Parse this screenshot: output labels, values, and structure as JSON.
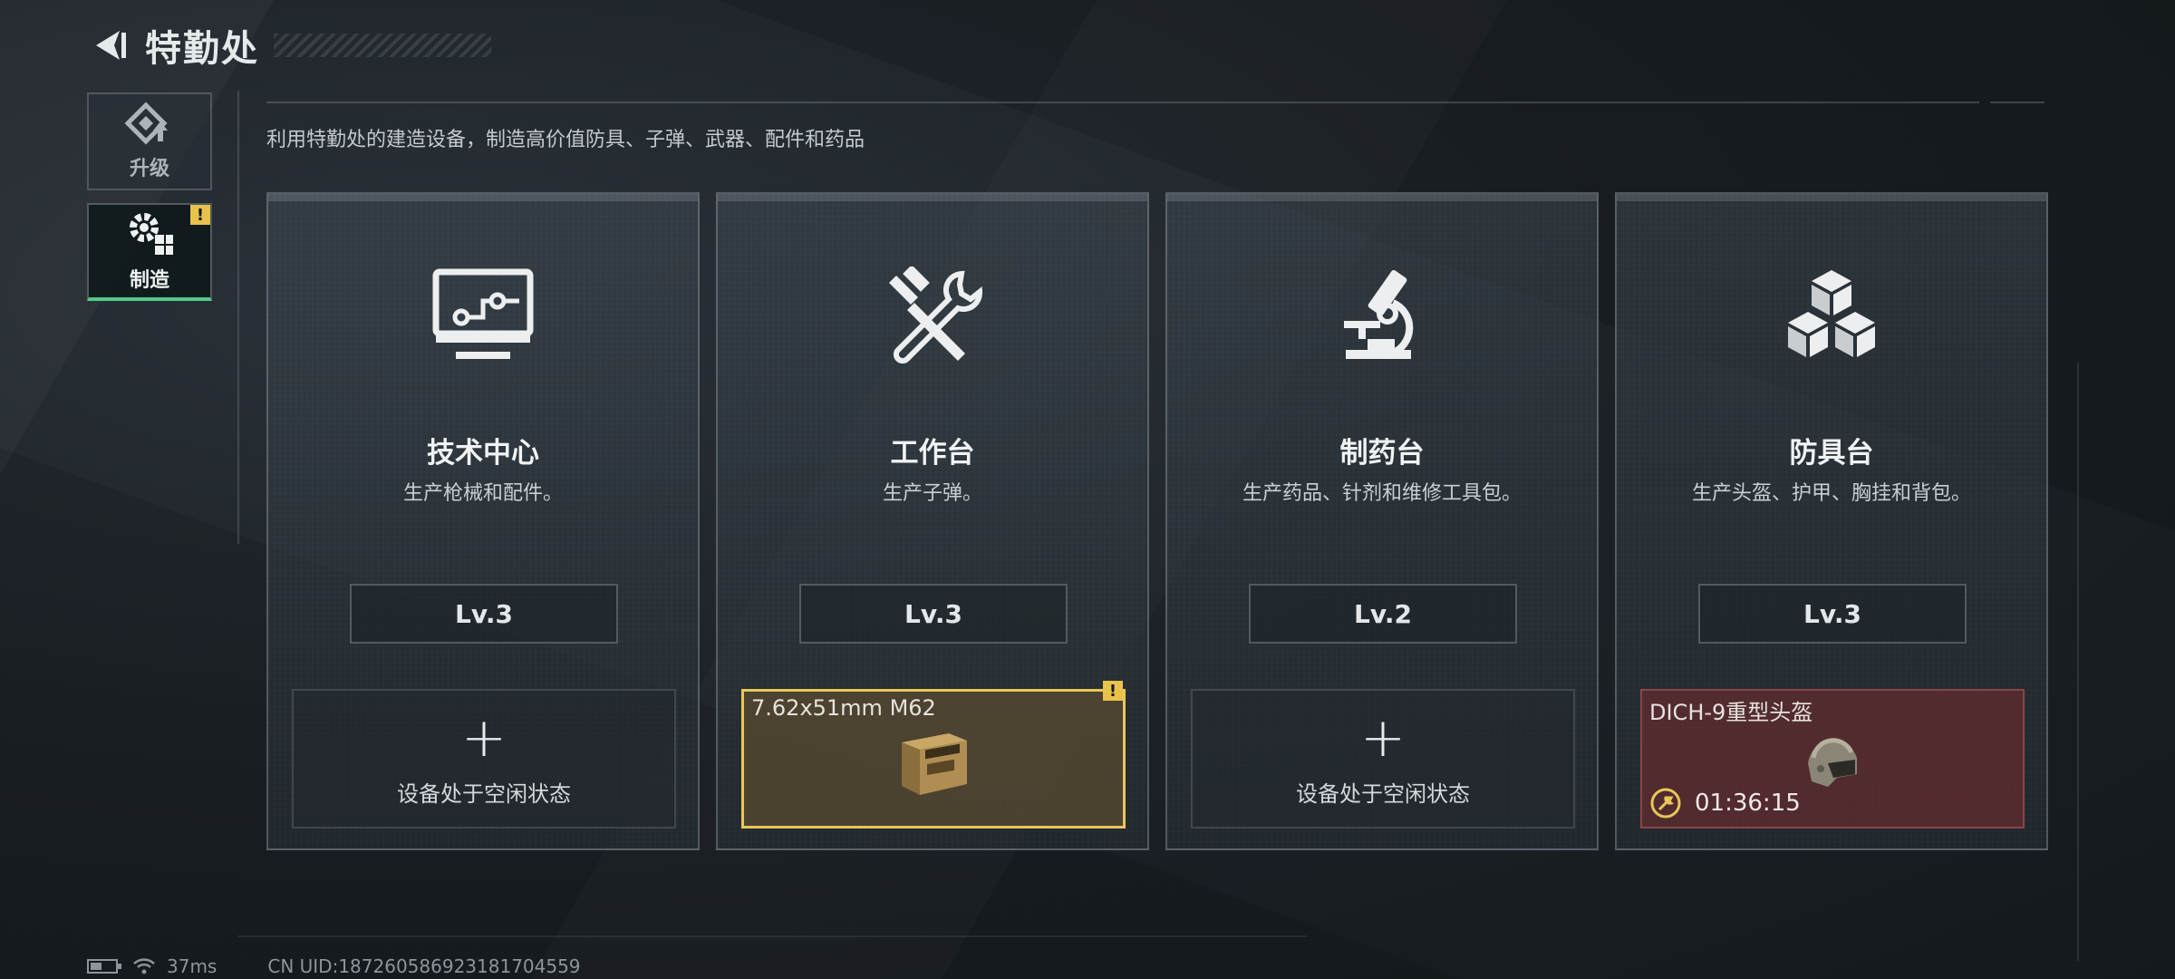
{
  "header": {
    "title": "特勤处"
  },
  "description": "利用特勤处的建造设备，制造高价值防具、子弹、武器、配件和药品",
  "side_tabs": [
    {
      "label": "升级",
      "icon": "upgrade-icon",
      "active": false
    },
    {
      "label": "制造",
      "icon": "gear-icon",
      "active": true,
      "badge": "!"
    }
  ],
  "cards": [
    {
      "name": "技术中心",
      "subtitle": "生产枪械和配件。",
      "level": "Lv.3",
      "icon": "monitor-icon",
      "slot": {
        "state": "idle",
        "text": "设备处于空闲状态"
      }
    },
    {
      "name": "工作台",
      "subtitle": "生产子弹。",
      "level": "Lv.3",
      "icon": "tools-icon",
      "slot": {
        "state": "ready",
        "item": "7.62x51mm M62",
        "badge": "!"
      }
    },
    {
      "name": "制药台",
      "subtitle": "生产药品、针剂和维修工具包。",
      "level": "Lv.2",
      "icon": "microscope-icon",
      "slot": {
        "state": "idle",
        "text": "设备处于空闲状态"
      }
    },
    {
      "name": "防具台",
      "subtitle": "生产头盔、护甲、胸挂和背包。",
      "level": "Lv.3",
      "icon": "cubes-icon",
      "slot": {
        "state": "producing",
        "item": "DICH-9重型头盔",
        "timer": "01:36:15"
      }
    }
  ],
  "footer": {
    "ping": "37ms",
    "uid": "CN UID:18726058692318170​4559"
  },
  "colors": {
    "accent_green": "#4fc98a",
    "badge_yellow": "#e8c24a",
    "slot_yellow": "#e8c65a",
    "slot_red": "#602c2e"
  }
}
